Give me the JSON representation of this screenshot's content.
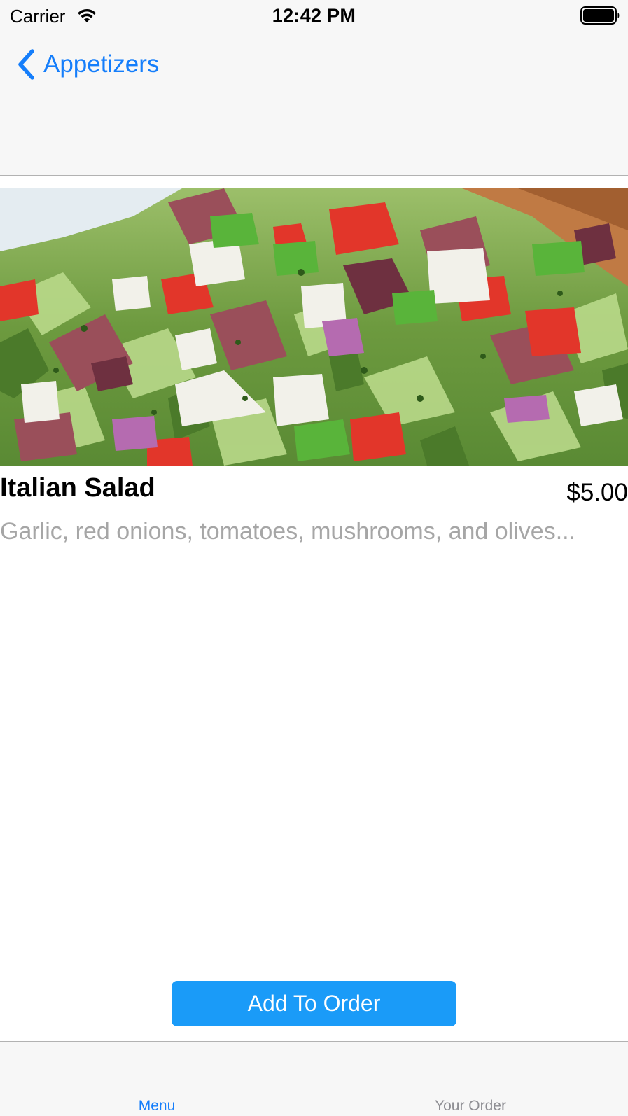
{
  "status_bar": {
    "carrier": "Carrier",
    "time": "12:42 PM",
    "icons": [
      "wifi-icon",
      "battery-icon"
    ]
  },
  "nav_bar": {
    "back_label": "Appetizers",
    "back_icon": "chevron-left-icon",
    "accent_color": "#157efb"
  },
  "item": {
    "image": "italian-salad-photo",
    "name": "Italian Salad",
    "price": "$5.00",
    "description": "Garlic, red onions, tomatoes, mushrooms, and olives..."
  },
  "actions": {
    "add_to_order_label": "Add To Order",
    "button_color": "#1a9bf8"
  },
  "tab_bar": {
    "tabs": [
      {
        "label": "Menu",
        "selected": true
      },
      {
        "label": "Your Order",
        "selected": false
      }
    ]
  }
}
